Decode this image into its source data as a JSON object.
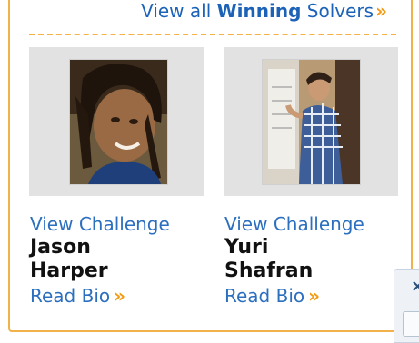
{
  "header": {
    "view_all_prefix": "View all ",
    "view_all_bold": "Winning",
    "view_all_suffix": " Solvers",
    "view_all_arrow": "»"
  },
  "solvers": [
    {
      "view_challenge": "View Challenge",
      "first_name": "Jason",
      "last_name": "Harper",
      "read_bio": "Read Bio",
      "read_bio_arrow": "»"
    },
    {
      "view_challenge": "View Challenge",
      "first_name": "Yuri",
      "last_name": "Shafran",
      "read_bio": "Read Bio",
      "read_bio_arrow": "»"
    }
  ],
  "side_widget": {
    "close_glyph": "×"
  },
  "colors": {
    "accent_orange": "#f39b12",
    "panel_border": "#f2b24a",
    "link_blue": "#2c6fbf"
  }
}
